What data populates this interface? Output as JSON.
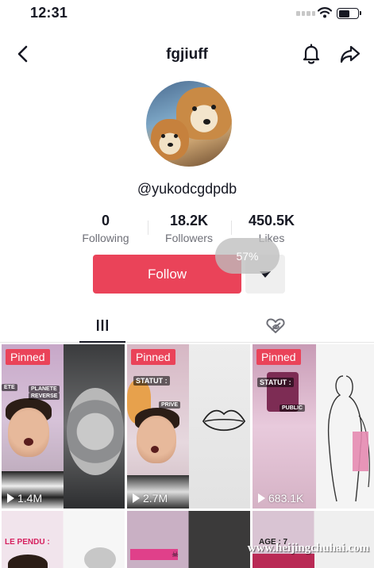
{
  "status_bar": {
    "time": "12:31",
    "battery_level": 0.6
  },
  "header": {
    "title": "fgjiuff",
    "back_icon": "chevron-left-icon",
    "bell_icon": "bell-icon",
    "share_icon": "share-arrow-icon"
  },
  "profile": {
    "username": "@yukodcgdpdb"
  },
  "stats": [
    {
      "value": "0",
      "label": "Following"
    },
    {
      "value": "18.2K",
      "label": "Followers"
    },
    {
      "value": "450.5K",
      "label": "Likes"
    }
  ],
  "actions": {
    "follow_label": "Follow",
    "dropdown_icon": "triangle-down-icon"
  },
  "overlay": {
    "progress_text": "57%",
    "progress_value": 0.57
  },
  "tabs": [
    {
      "icon": "grid-icon",
      "selected": true
    },
    {
      "icon": "liked-heart-icon",
      "selected": false
    }
  ],
  "videos": [
    {
      "pinned": "Pinned",
      "views": "1.4M",
      "stickers": [
        "PLANETE",
        "REVERSE",
        "ETE"
      ]
    },
    {
      "pinned": "Pinned",
      "views": "2.7M",
      "stickers": [
        "STATUT :",
        "PRIVE"
      ]
    },
    {
      "pinned": "Pinned",
      "views": "683.1K",
      "stickers": [
        "STATUT :",
        "PUBLIC"
      ]
    },
    {
      "pinned": "",
      "views": "",
      "stickers": []
    }
  ],
  "second_row": [
    {
      "text": "LE PENDU :"
    },
    {
      "text": ""
    },
    {
      "text": ""
    },
    {
      "text": "AGE : 7"
    }
  ],
  "watermark": "www.heijingchuhai.com",
  "colors": {
    "accent": "#ea4359",
    "text": "#161823",
    "secondary": "#6f7078"
  }
}
